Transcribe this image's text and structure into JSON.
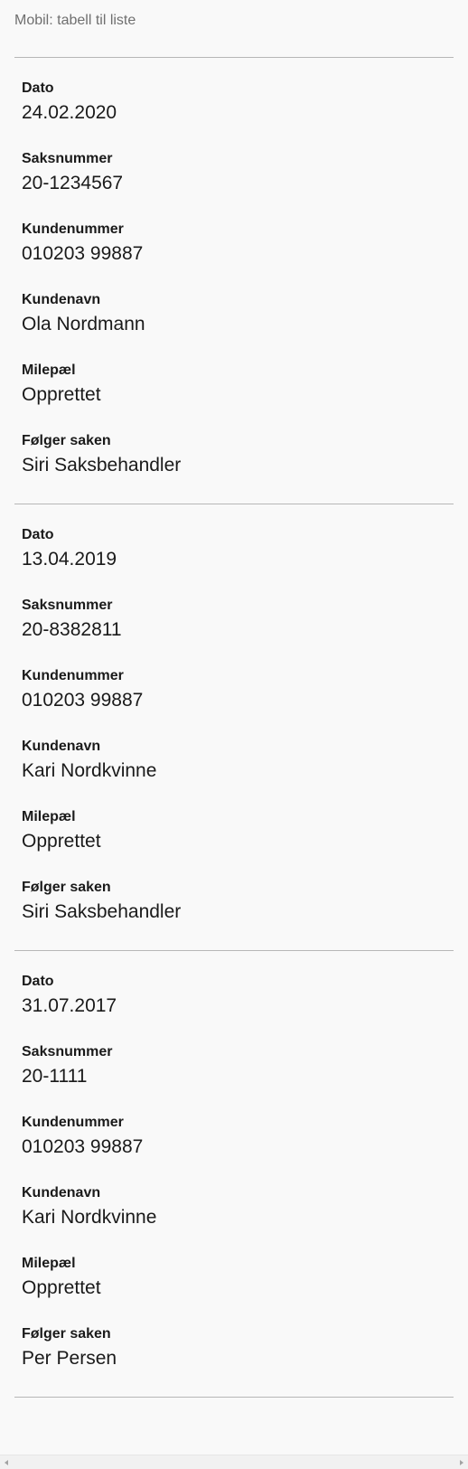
{
  "caption": "Mobil: tabell til liste",
  "labels": {
    "dato": "Dato",
    "saksnummer": "Saksnummer",
    "kundenummer": "Kundenummer",
    "kundenavn": "Kundenavn",
    "milepael": "Milepæl",
    "folger": "Følger saken"
  },
  "rows": [
    {
      "dato": "24.02.2020",
      "saksnummer": "20-1234567",
      "kundenummer": "010203 99887",
      "kundenavn": "Ola Nordmann",
      "milepael": "Opprettet",
      "folger": "Siri Saksbehandler"
    },
    {
      "dato": "13.04.2019",
      "saksnummer": "20-8382811",
      "kundenummer": "010203 99887",
      "kundenavn": "Kari Nordkvinne",
      "milepael": "Opprettet",
      "folger": "Siri Saksbehandler"
    },
    {
      "dato": "31.07.2017",
      "saksnummer": "20-1111",
      "kundenummer": "010203 99887",
      "kundenavn": "Kari Nordkvinne",
      "milepael": "Opprettet",
      "folger": "Per Persen"
    }
  ],
  "scrollbar": {
    "left_icon": "scroll-left-arrow-icon",
    "right_icon": "scroll-right-arrow-icon"
  }
}
